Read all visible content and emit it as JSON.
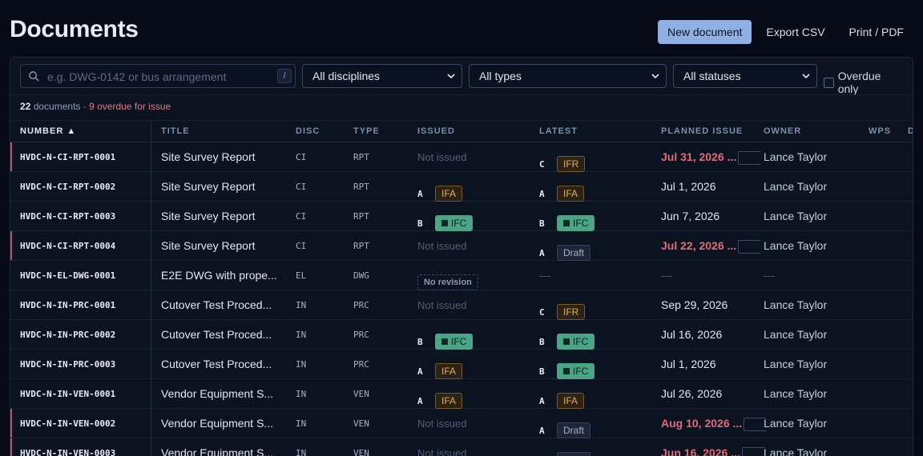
{
  "header": {
    "title": "Documents",
    "new_label": "New document",
    "export_label": "Export CSV",
    "print_label": "Print / PDF"
  },
  "filters": {
    "search_placeholder": "e.g. DWG-0142 or bus arrangement",
    "search_shortcut": "/",
    "discipline": "All disciplines",
    "type": "All types",
    "status": "All statuses",
    "overdue_label": "Overdue only"
  },
  "summary": {
    "count": "22",
    "count_suffix": "documents",
    "sep": "·",
    "overdue_count": "9",
    "overdue_suffix": "overdue for issue"
  },
  "columns": {
    "number": "NUMBER ▲",
    "title": "TITLE",
    "disc": "DISC",
    "type": "TYPE",
    "issued": "ISSUED",
    "latest": "LATEST",
    "planned": "PLANNED ISSUE",
    "owner": "OWNER",
    "wps": "WPS",
    "d": "D"
  },
  "colors": {
    "accent": "#8fb0e3",
    "overdue": "#e06c7a",
    "ifc": "#4aa586",
    "ifa": "#e2ae55"
  },
  "rows": [
    {
      "number": "HVDC-N-CI-RPT-0001",
      "title": "Site Survey Report",
      "disc": "CI",
      "type": "RPT",
      "issued_rev": "",
      "issued_status": "Not issued",
      "latest_rev": "C",
      "latest_status": "IFR",
      "planned": "Jul 31, 2026 ...",
      "overdue": true,
      "owner": "Lance Taylor"
    },
    {
      "number": "HVDC-N-CI-RPT-0002",
      "title": "Site Survey Report",
      "disc": "CI",
      "type": "RPT",
      "issued_rev": "A",
      "issued_status": "IFA",
      "latest_rev": "A",
      "latest_status": "IFA",
      "planned": "Jul 1, 2026",
      "overdue": false,
      "owner": "Lance Taylor"
    },
    {
      "number": "HVDC-N-CI-RPT-0003",
      "title": "Site Survey Report",
      "disc": "CI",
      "type": "RPT",
      "issued_rev": "B",
      "issued_status": "IFC",
      "latest_rev": "B",
      "latest_status": "IFC",
      "planned": "Jun 7, 2026",
      "overdue": false,
      "owner": "Lance Taylor"
    },
    {
      "number": "HVDC-N-CI-RPT-0004",
      "title": "Site Survey Report",
      "disc": "CI",
      "type": "RPT",
      "issued_rev": "",
      "issued_status": "Not issued",
      "latest_rev": "A",
      "latest_status": "Draft",
      "planned": "Jul 22, 2026 ...",
      "overdue": true,
      "owner": "Lance Taylor"
    },
    {
      "number": "HVDC-N-EL-DWG-0001",
      "title": "E2E DWG with prope...",
      "disc": "EL",
      "type": "DWG",
      "issued_rev": "",
      "issued_status": "No revision",
      "latest_rev": "",
      "latest_status": "—",
      "planned": "—",
      "overdue": false,
      "owner": "—"
    },
    {
      "number": "HVDC-N-IN-PRC-0001",
      "title": "Cutover Test Proced...",
      "disc": "IN",
      "type": "PRC",
      "issued_rev": "",
      "issued_status": "Not issued",
      "latest_rev": "C",
      "latest_status": "IFR",
      "planned": "Sep 29, 2026",
      "overdue": false,
      "owner": "Lance Taylor"
    },
    {
      "number": "HVDC-N-IN-PRC-0002",
      "title": "Cutover Test Proced...",
      "disc": "IN",
      "type": "PRC",
      "issued_rev": "B",
      "issued_status": "IFC",
      "latest_rev": "B",
      "latest_status": "IFC",
      "planned": "Jul 16, 2026",
      "overdue": false,
      "owner": "Lance Taylor"
    },
    {
      "number": "HVDC-N-IN-PRC-0003",
      "title": "Cutover Test Proced...",
      "disc": "IN",
      "type": "PRC",
      "issued_rev": "A",
      "issued_status": "IFA",
      "latest_rev": "B",
      "latest_status": "IFC",
      "planned": "Jul 1, 2026",
      "overdue": false,
      "owner": "Lance Taylor"
    },
    {
      "number": "HVDC-N-IN-VEN-0001",
      "title": "Vendor Equipment S...",
      "disc": "IN",
      "type": "VEN",
      "issued_rev": "A",
      "issued_status": "IFA",
      "latest_rev": "A",
      "latest_status": "IFA",
      "planned": "Jul 26, 2026",
      "overdue": false,
      "owner": "Lance Taylor"
    },
    {
      "number": "HVDC-N-IN-VEN-0002",
      "title": "Vendor Equipment S...",
      "disc": "IN",
      "type": "VEN",
      "issued_rev": "",
      "issued_status": "Not issued",
      "latest_rev": "A",
      "latest_status": "Draft",
      "planned": "Aug 10, 2026 ...",
      "overdue": true,
      "owner": "Lance Taylor"
    },
    {
      "number": "HVDC-N-IN-VEN-0003",
      "title": "Vendor Equipment S...",
      "disc": "IN",
      "type": "VEN",
      "issued_rev": "",
      "issued_status": "Not issued",
      "latest_rev": "A",
      "latest_status": "Draft",
      "planned": "Jun 16, 2026 ...",
      "overdue": true,
      "owner": "Lance Taylor"
    }
  ]
}
